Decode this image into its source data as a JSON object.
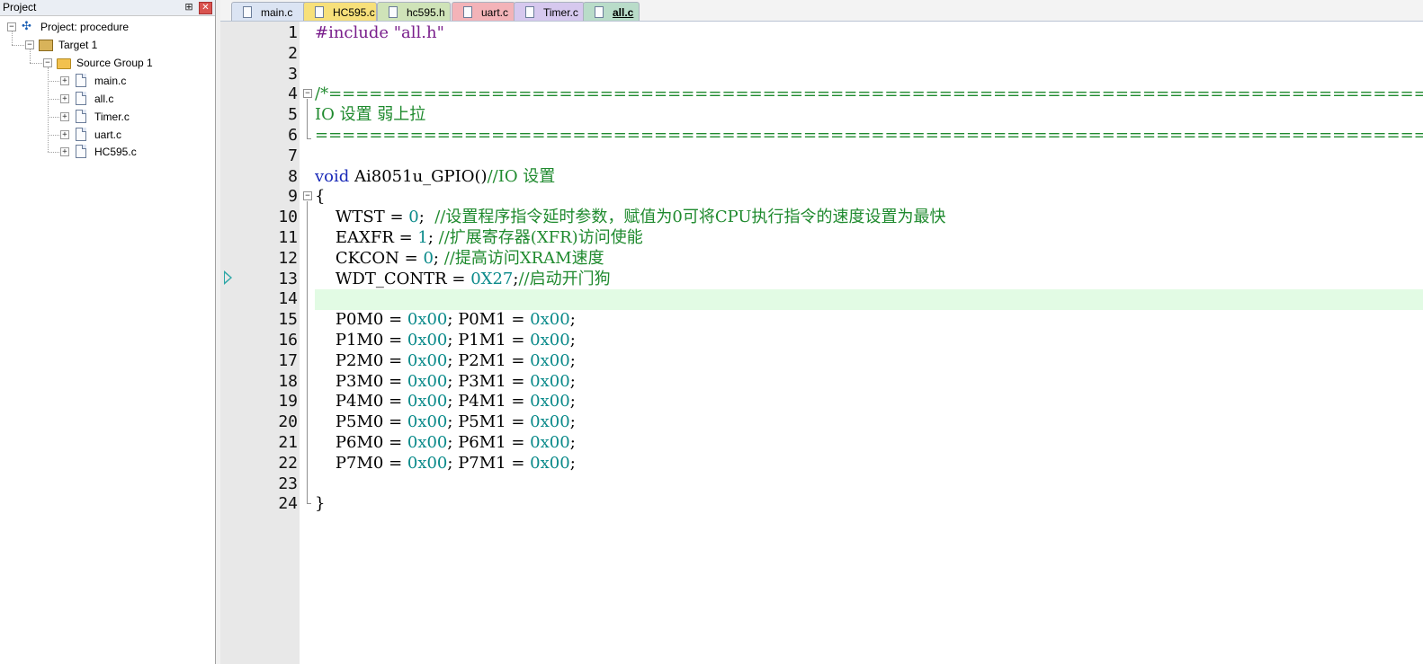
{
  "project_panel": {
    "title": "Project",
    "pin_glyph": "⊞",
    "close_glyph": "✕",
    "tree": {
      "project": "Project: procedure",
      "target": "Target 1",
      "group": "Source Group 1",
      "files": [
        "main.c",
        "all.c",
        "Timer.c",
        "uart.c",
        "HC595.c"
      ]
    },
    "expander_minus": "−",
    "expander_plus": "+"
  },
  "tabs": [
    {
      "label": "main.c",
      "color": "#dbe4f3",
      "active": false
    },
    {
      "label": "HC595.c",
      "color": "#f7e07a",
      "active": false
    },
    {
      "label": "hc595.h",
      "color": "#cfe3b8",
      "active": false
    },
    {
      "label": "uart.c",
      "color": "#f3b3b8",
      "active": false
    },
    {
      "label": "Timer.c",
      "color": "#d6c8ee",
      "active": false
    },
    {
      "label": "all.c",
      "color": "#b9dcc9",
      "active": true
    }
  ],
  "editor": {
    "line_numbers": [
      "1",
      "2",
      "3",
      "4",
      "5",
      "6",
      "7",
      "8",
      "9",
      "10",
      "11",
      "12",
      "13",
      "14",
      "15",
      "16",
      "17",
      "18",
      "19",
      "20",
      "21",
      "22",
      "23",
      "24"
    ],
    "current_line": 13,
    "highlighted_line": 14,
    "lines": {
      "l1_pre": "#include ",
      "l1_str": "\"all.h\"",
      "l4": "/*==============================================================================================================================",
      "l5": "IO 设置 弱上拉",
      "l6": "================================================================================================================================",
      "l8_kw": "void",
      "l8_fn": " Ai8051u_GPIO()",
      "l8_cm": "//IO 设置",
      "l9": "{",
      "l10_a": "    WTST = ",
      "l10_n": "0",
      "l10_b": ";  ",
      "l10_cm": "//设置程序指令延时参数，赋值为0可将CPU执行指令的速度设置为最快",
      "l11_a": "    EAXFR = ",
      "l11_n": "1",
      "l11_b": "; ",
      "l11_cm": "//扩展寄存器(XFR)访问使能",
      "l12_a": "    CKCON = ",
      "l12_n": "0",
      "l12_b": "; ",
      "l12_cm": "//提高访问XRAM速度",
      "l13_a": "    WDT_CONTR = ",
      "l13_n": "0X27",
      "l13_b": ";",
      "l13_cm": "//启动开门狗",
      "ports": [
        {
          "m0": "P0M0",
          "m1": "P0M1"
        },
        {
          "m0": "P1M0",
          "m1": "P1M1"
        },
        {
          "m0": "P2M0",
          "m1": "P2M1"
        },
        {
          "m0": "P3M0",
          "m1": "P3M1"
        },
        {
          "m0": "P4M0",
          "m1": "P4M1"
        },
        {
          "m0": "P5M0",
          "m1": "P5M1"
        },
        {
          "m0": "P6M0",
          "m1": "P6M1"
        },
        {
          "m0": "P7M0",
          "m1": "P7M1"
        }
      ],
      "port_value": "0x00",
      "l24": "}"
    }
  }
}
